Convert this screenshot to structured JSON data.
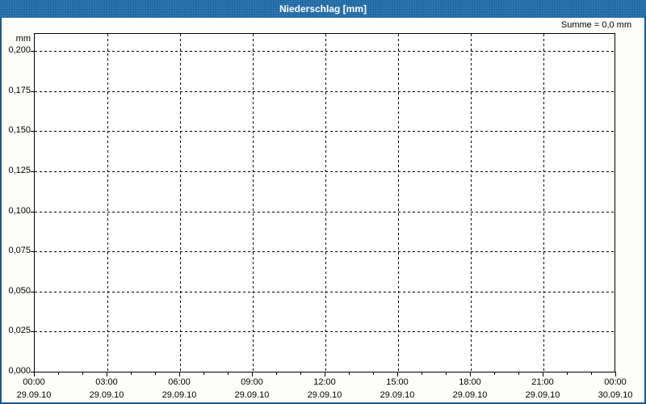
{
  "window": {
    "title": "Niederschlag [mm]"
  },
  "header": {
    "sum_text": "Summe = 0,0 mm"
  },
  "colors": {
    "titlebar": "#1F69A4",
    "frame_border": "#185A92",
    "title_text": "#FFFFFF",
    "label_text": "#000000",
    "grid": "#000000",
    "plot_background": "#FFFFFF",
    "page_background": "#FDFEFA"
  },
  "chart_data": {
    "type": "line",
    "title": "Niederschlag [mm]",
    "ylabel": "mm",
    "ylim": [
      0,
      0.2
    ],
    "grid": "dashed",
    "legend": "none",
    "y_ticks": [
      {
        "label": "0,200",
        "value": 0.2
      },
      {
        "label": "0,175",
        "value": 0.175
      },
      {
        "label": "0,150",
        "value": 0.15
      },
      {
        "label": "0,125",
        "value": 0.125
      },
      {
        "label": "0,100",
        "value": 0.1
      },
      {
        "label": "0,075",
        "value": 0.075
      },
      {
        "label": "0,050",
        "value": 0.05
      },
      {
        "label": "0,025",
        "value": 0.025
      },
      {
        "label": "0,000",
        "value": 0.0
      }
    ],
    "x_ticks": [
      {
        "time": "00:00",
        "date": "29.09.10"
      },
      {
        "time": "03:00",
        "date": "29.09.10"
      },
      {
        "time": "06:00",
        "date": "29.09.10"
      },
      {
        "time": "09:00",
        "date": "29.09.10"
      },
      {
        "time": "12:00",
        "date": "29.09.10"
      },
      {
        "time": "15:00",
        "date": "29.09.10"
      },
      {
        "time": "18:00",
        "date": "29.09.10"
      },
      {
        "time": "21:00",
        "date": "29.09.10"
      },
      {
        "time": "00:00",
        "date": "30.09.10"
      }
    ],
    "x_major_interval_hours": 3,
    "x_minor_interval_hours": 1,
    "series": [
      {
        "name": "Niederschlag",
        "values": [],
        "sum_mm": 0.0
      }
    ],
    "annotations": [
      "Summe = 0,0 mm"
    ]
  }
}
